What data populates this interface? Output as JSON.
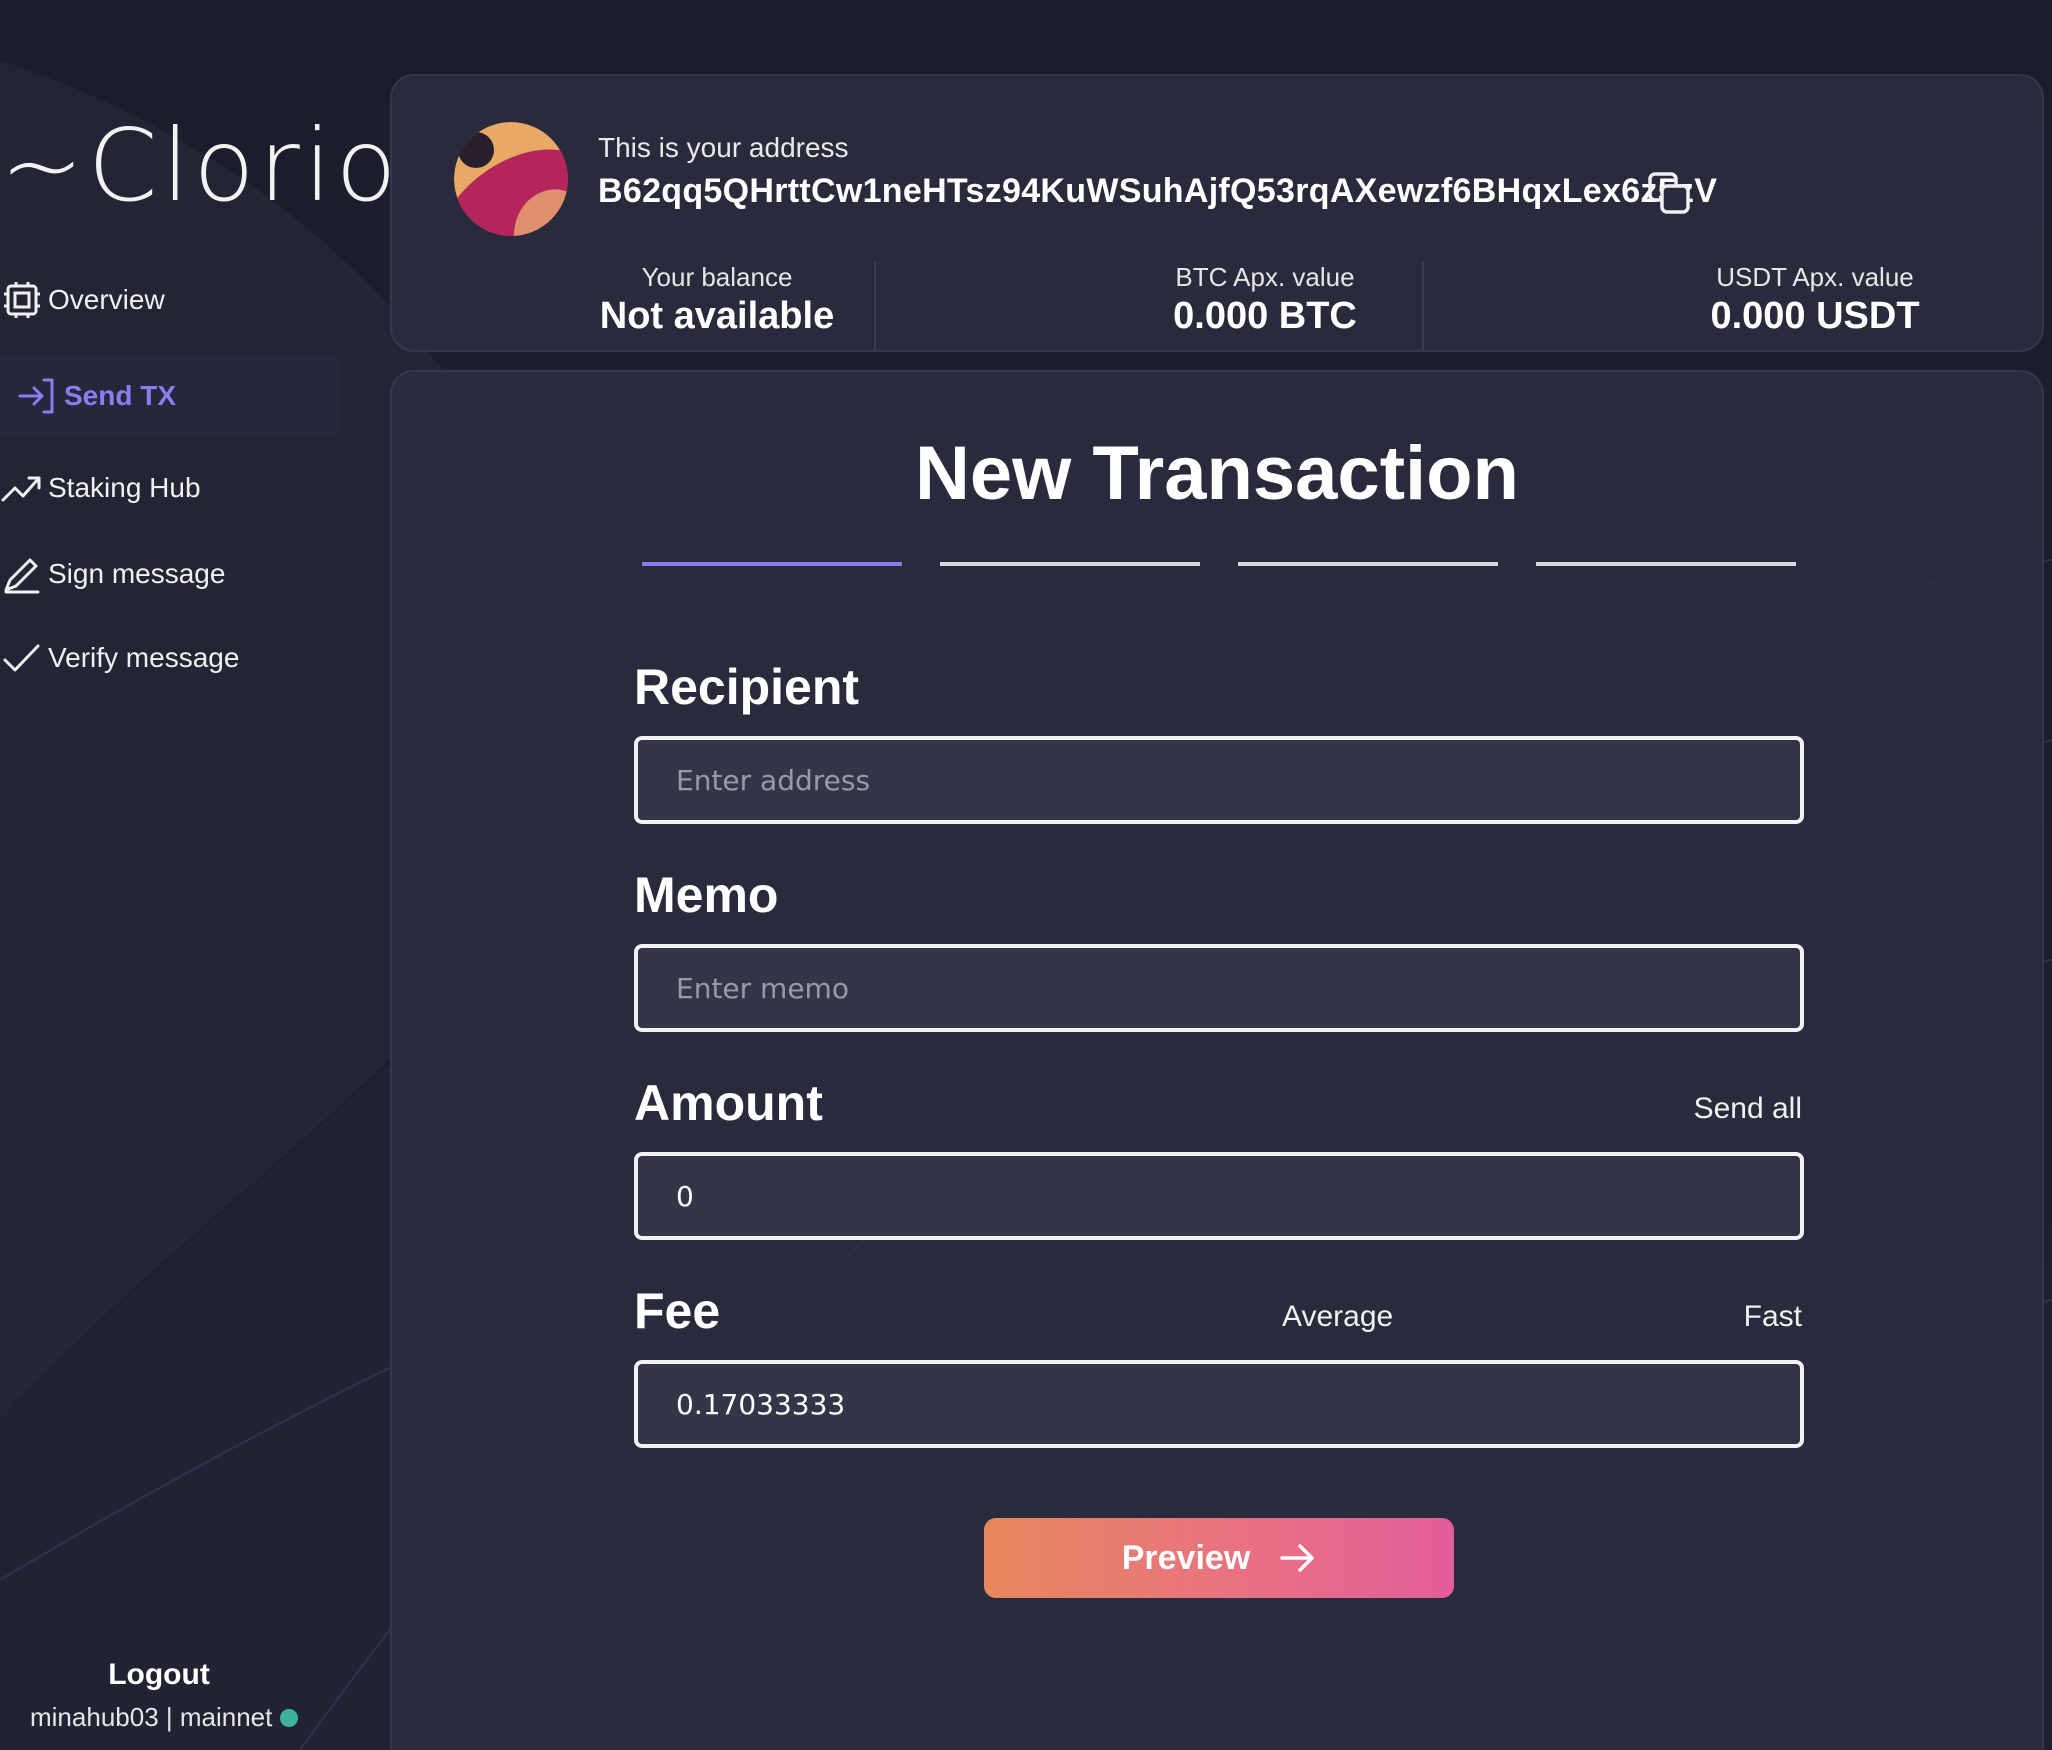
{
  "app": {
    "logo_text": "~Clorio"
  },
  "sidebar": {
    "items": [
      {
        "label": "Overview",
        "icon": "chip-icon",
        "active": false
      },
      {
        "label": "Send TX",
        "icon": "send-icon",
        "active": true
      },
      {
        "label": "Staking Hub",
        "icon": "trending-up-icon",
        "active": false
      },
      {
        "label": "Sign message",
        "icon": "pen-icon",
        "active": false
      },
      {
        "label": "Verify message",
        "icon": "check-icon",
        "active": false
      }
    ],
    "logout_label": "Logout",
    "account": "minahub03 | mainnet",
    "status_color": "#3bb39a"
  },
  "header": {
    "address_label": "This is your address",
    "address": "B62qq5QHrttCw1neHTsz94KuWSuhAjfQ53rqAXewzf6BHqxLex6z5zV",
    "balance": {
      "label": "Your balance",
      "value": "Not available"
    },
    "btc": {
      "label": "BTC Apx. value",
      "value": "0.000 BTC"
    },
    "usdt": {
      "label": "USDT Apx. value",
      "value": "0.000 USDT"
    }
  },
  "form": {
    "title": "New Transaction",
    "steps_total": 4,
    "active_step": 1,
    "recipient": {
      "label": "Recipient",
      "placeholder": "Enter address",
      "value": ""
    },
    "memo": {
      "label": "Memo",
      "placeholder": "Enter memo",
      "value": ""
    },
    "amount": {
      "label": "Amount",
      "value": "0",
      "send_all_label": "Send all"
    },
    "fee": {
      "label": "Fee",
      "value": "0.17033333",
      "average_label": "Average",
      "fast_label": "Fast"
    },
    "preview_label": "Preview"
  },
  "colors": {
    "accent": "#8b7cf0",
    "button_gradient_start": "#e8885c",
    "button_gradient_end": "#e35d9a",
    "background": "#1d1f2d",
    "card": "#2b2d3f"
  }
}
